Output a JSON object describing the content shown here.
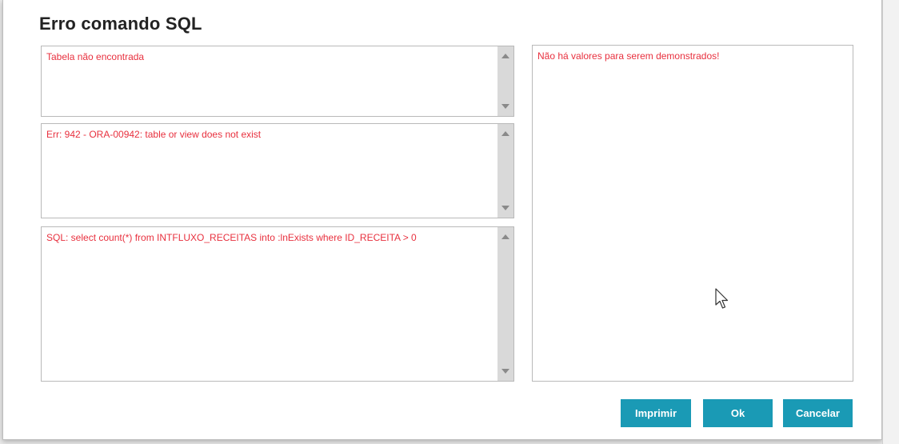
{
  "dialog": {
    "title": "Erro comando SQL"
  },
  "messages": {
    "error_message": "Tabela não encontrada",
    "error_detail": "Err: 942 - ORA-00942: table or view does not exist",
    "sql_statement": "SQL: select count(*) from INTFLUXO_RECEITAS into :lnExists where ID_RECEITA > 0",
    "values_panel": "Não há valores para serem demonstrados!"
  },
  "buttons": {
    "print_label": "Imprimir",
    "ok_label": "Ok",
    "cancel_label": "Cancelar"
  },
  "colors": {
    "error_text": "#e8303e",
    "button_bg": "#1a9ab5",
    "button_text": "#ffffff"
  },
  "icons": {
    "scroll_up": "chevron-up-icon",
    "scroll_down": "chevron-down-icon",
    "cursor": "mouse-pointer-icon"
  }
}
